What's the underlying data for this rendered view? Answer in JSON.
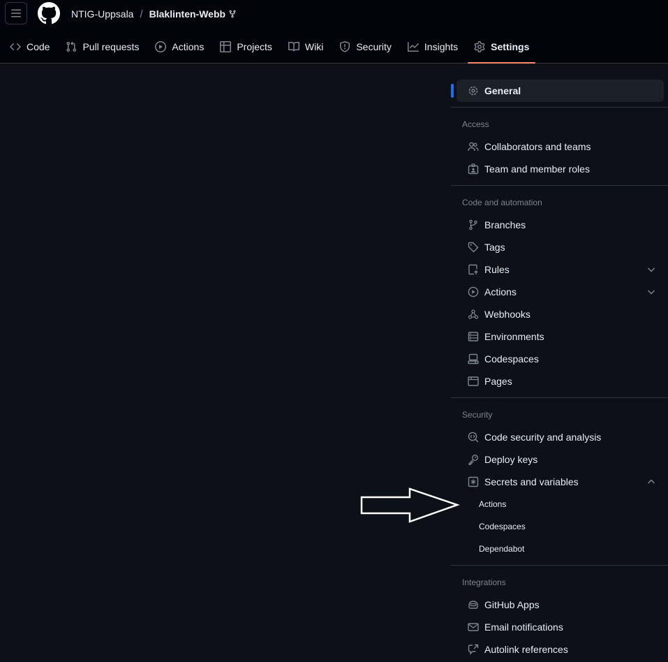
{
  "breadcrumb": {
    "owner": "NTIG-Uppsala",
    "separator": "/",
    "repo": "Blaklinten-Webb"
  },
  "tabs": [
    {
      "label": "Code",
      "icon": "code-icon"
    },
    {
      "label": "Pull requests",
      "icon": "git-pull-request-icon"
    },
    {
      "label": "Actions",
      "icon": "play-icon"
    },
    {
      "label": "Projects",
      "icon": "table-icon"
    },
    {
      "label": "Wiki",
      "icon": "book-icon"
    },
    {
      "label": "Security",
      "icon": "shield-icon"
    },
    {
      "label": "Insights",
      "icon": "graph-icon"
    },
    {
      "label": "Settings",
      "icon": "gear-icon",
      "active": true
    }
  ],
  "sidebar": {
    "general": "General",
    "access_label": "Access",
    "access": [
      "Collaborators and teams",
      "Team and member roles"
    ],
    "code_label": "Code and automation",
    "code": [
      "Branches",
      "Tags",
      "Rules",
      "Actions",
      "Webhooks",
      "Environments",
      "Codespaces",
      "Pages"
    ],
    "security_label": "Security",
    "security": [
      "Code security and analysis",
      "Deploy keys",
      "Secrets and variables"
    ],
    "secrets_sub": [
      "Actions",
      "Codespaces",
      "Dependabot"
    ],
    "integrations_label": "Integrations",
    "integrations": [
      "GitHub Apps",
      "Email notifications",
      "Autolink references"
    ]
  },
  "colors": {
    "accent_tab": "#fd8c73",
    "selected_bar": "#1f6feb",
    "background": "#0d1117"
  }
}
